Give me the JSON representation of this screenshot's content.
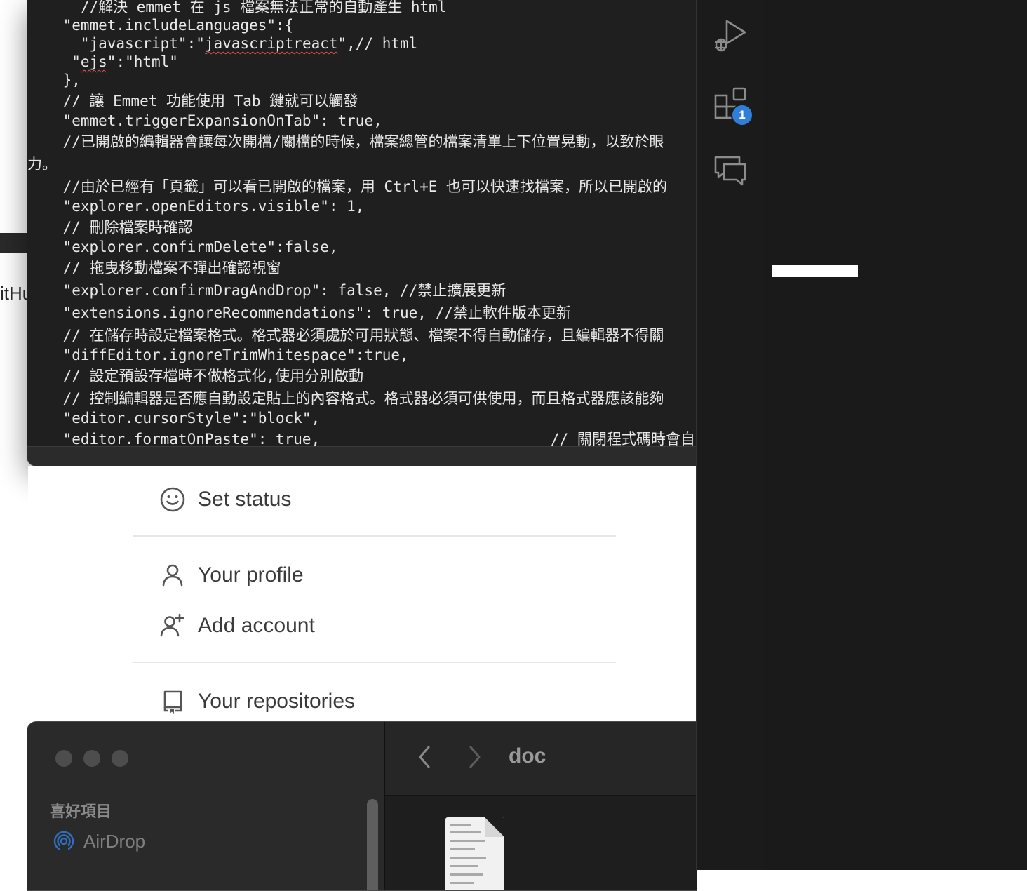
{
  "editor": {
    "lines": [
      "      //解決 emmet 在 js 檔案無法正常的自動產生 html",
      "    \"emmet.includeLanguages\":{",
      "      \"javascript\":\"javascriptreact\",// html",
      "     \"ejs\":\"html\"",
      "    },",
      "    // 讓 Emmet 功能使用 Tab 鍵就可以觸發",
      "    \"emmet.triggerExpansionOnTab\": true,",
      "    //已開啟的編輯器會讓每次開檔/關檔的時候，檔案總管的檔案清單上下位置晃動，以致於眼",
      "力。",
      "    //由於已經有「頁籤」可以看已開啟的檔案，用 Ctrl+E 也可以快速找檔案，所以已開啟的",
      "    \"explorer.openEditors.visible\": 1,",
      "    // 刪除檔案時確認",
      "    \"explorer.confirmDelete\":false,",
      "    // 拖曳移動檔案不彈出確認視窗",
      "    \"explorer.confirmDragAndDrop\": false, //禁止擴展更新",
      "    \"extensions.ignoreRecommendations\": true, //禁止軟件版本更新",
      "    // 在儲存時設定檔案格式。格式器必須處於可用狀態、檔案不得自動儲存，且編輯器不得關",
      "    \"diffEditor.ignoreTrimWhitespace\":true,",
      "    // 設定預設存檔時不做格式化,使用分別啟動",
      "    // 控制編輯器是否應自動設定貼上的內容格式。格式器必須可供使用，而且格式器應該能夠",
      "    \"editor.cursorStyle\":\"block\",",
      "    \"editor.formatOnPaste\": true,                          // 關閉程式碼時會自"
    ]
  },
  "background": {
    "partial_text": "itHu"
  },
  "github_menu": {
    "set_status": "Set status",
    "your_profile": "Your profile",
    "add_account": "Add account",
    "your_repositories": "Your repositories"
  },
  "finder": {
    "folder_name": "doc",
    "sidebar_header": "喜好項目",
    "airdrop_label": "AirDrop"
  },
  "activity_bar": {
    "extensions_badge": "1",
    "icons": [
      "run-debug-icon",
      "extensions-icon",
      "comments-icon"
    ]
  },
  "colors": {
    "editor_bg": "#1f1f1f",
    "badge": "#2f7fd8",
    "activity_bg": "#1b1b1b"
  }
}
